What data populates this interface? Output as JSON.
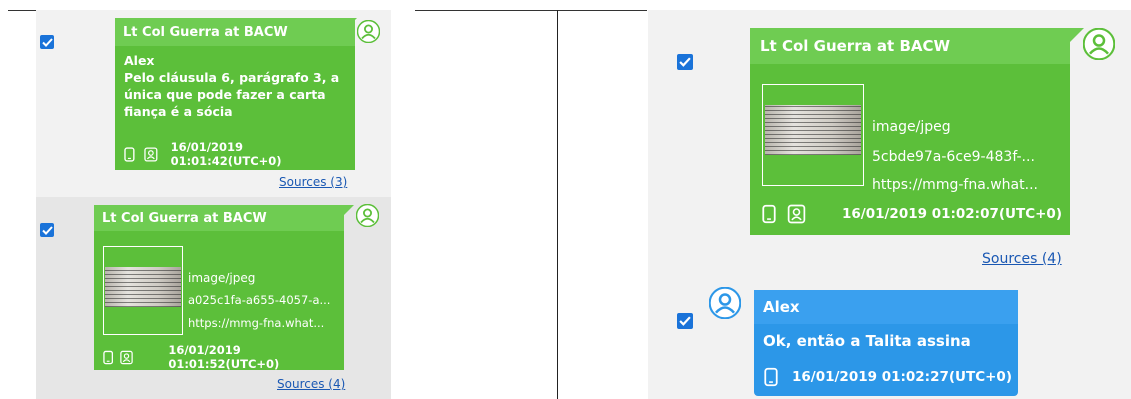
{
  "left": {
    "msg1": {
      "sender": "Lt Col Guerra at BACW",
      "lines": [
        "Alex",
        "Pelo cláusula 6, parágrafo 3, a",
        "única que pode fazer a carta",
        "fiança é a sócia"
      ],
      "timestamp": "16/01/2019 01:01:42(UTC+0)",
      "sources": "Sources (3)"
    },
    "msg2": {
      "sender": "Lt Col Guerra at BACW",
      "mime": "image/jpeg",
      "filename": "a025c1fa-a655-4057-a...",
      "url": "https://mmg-fna.what...",
      "timestamp": "16/01/2019 01:01:52(UTC+0)",
      "sources": "Sources (4)"
    }
  },
  "right": {
    "msg1": {
      "sender": "Lt Col Guerra at BACW",
      "mime": "image/jpeg",
      "filename": "5cbde97a-6ce9-483f-...",
      "url": "https://mmg-fna.what...",
      "timestamp": "16/01/2019 01:02:07(UTC+0)",
      "sources": "Sources (4)"
    },
    "msg2": {
      "sender": "Alex",
      "text": "Ok, então a Talita assina",
      "timestamp": "16/01/2019 01:02:27(UTC+0)"
    }
  },
  "colors": {
    "green_body": "#5cbf3a",
    "green_header": "#6fcc52",
    "blue_body": "#2c97e8",
    "blue_header": "#3aa0ef",
    "checkbox": "#1a73d9",
    "link": "#1a58b3"
  },
  "icons": [
    "checkbox-checked-icon",
    "contact-avatar-icon",
    "phone-icon",
    "contact-book-icon"
  ]
}
